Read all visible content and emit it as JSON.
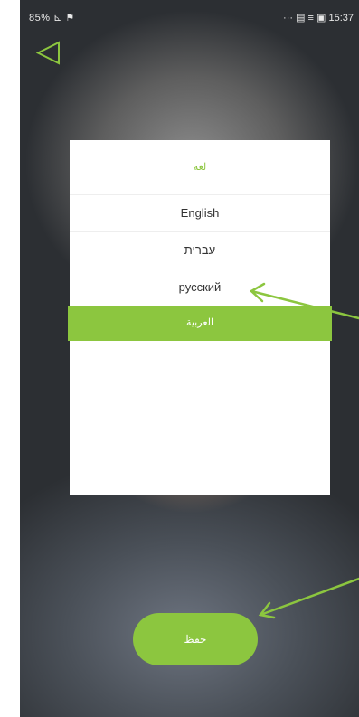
{
  "status_bar": {
    "left_text": "85% ⊾ ⚑",
    "right_text": "··· ▤ ≡ ▣ 15:37"
  },
  "dialog": {
    "title": "لغة",
    "options": [
      {
        "label": "English"
      },
      {
        "label": "עברית"
      },
      {
        "label": "русский"
      },
      {
        "label": "العربية",
        "selected": true
      }
    ]
  },
  "save_button": {
    "label": "حفظ"
  },
  "colors": {
    "accent": "#8cc63f",
    "annotation_arrow": "#8cc63f"
  },
  "icons": {
    "back": "back-triangle-icon"
  }
}
